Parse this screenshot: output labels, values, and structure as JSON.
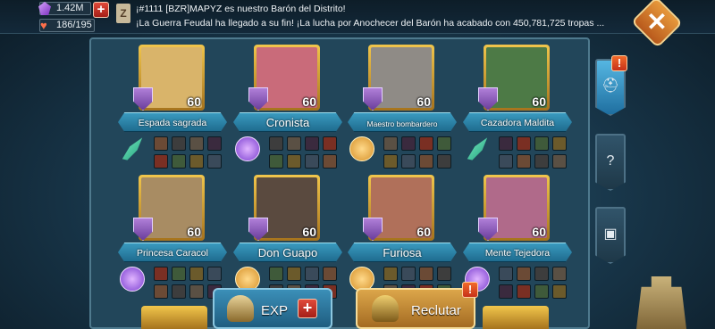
{
  "resources": {
    "gems": "1.42M",
    "stamina": "186/195"
  },
  "news": {
    "line1": "¡#1111 [BZR]MAPYZ es nuestro Barón del Distrito!",
    "line2": "¡La Guerra Feudal ha llegado a su fin! ¡La lucha por Anochecer del Barón ha acabado con 450,781,725 tropas ..."
  },
  "close_label": "✕",
  "heroes": [
    {
      "name": "Espada sagrada",
      "level": "60",
      "trait": "feather",
      "color": "#d9b46a"
    },
    {
      "name": "Cronista",
      "level": "60",
      "trait": "orb",
      "color": "#c96b7a"
    },
    {
      "name": "Maestro bombardero",
      "level": "60",
      "trait": "fist",
      "color": "#8f8b86"
    },
    {
      "name": "Cazadora Maldita",
      "level": "60",
      "trait": "feather",
      "color": "#4d7a46"
    },
    {
      "name": "Princesa Caracol",
      "level": "60",
      "trait": "orb",
      "color": "#a88c63"
    },
    {
      "name": "Don Guapo",
      "level": "60",
      "trait": "fist",
      "color": "#5a4a3f"
    },
    {
      "name": "Furiosa",
      "level": "60",
      "trait": "fist",
      "color": "#b0705a"
    },
    {
      "name": "Mente Tejedora",
      "level": "60",
      "trait": "orb",
      "color": "#b06a8a"
    }
  ],
  "gear_colors": [
    "#6b4a35",
    "#3d3d3d",
    "#5a5044",
    "#3a2a3e",
    "#7a2f23",
    "#3f5a3a",
    "#6b5a2b",
    "#3a4a5a"
  ],
  "buttons": {
    "exp": "EXP",
    "exp_plus": "+",
    "recruit": "Reclutar",
    "badge": "!"
  },
  "tabs": [
    "helmet",
    "question",
    "chest"
  ]
}
